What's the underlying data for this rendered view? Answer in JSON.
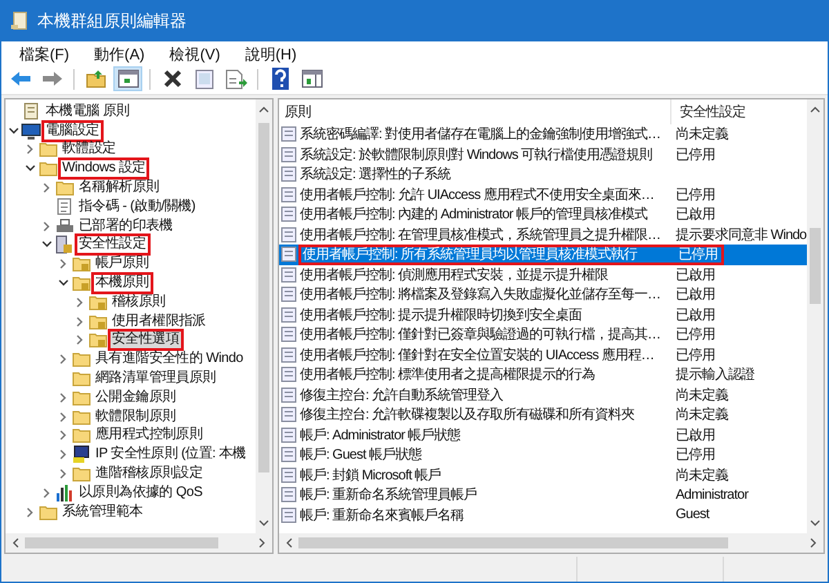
{
  "window": {
    "title": "本機群組原則編輯器"
  },
  "menu": [
    {
      "label": "檔案(F)"
    },
    {
      "label": "動作(A)"
    },
    {
      "label": "檢視(V)"
    },
    {
      "label": "說明(H)"
    }
  ],
  "toolbar": [
    {
      "kind": "back",
      "selected": false
    },
    {
      "kind": "forward",
      "selected": false
    },
    {
      "kind": "sep"
    },
    {
      "kind": "up",
      "selected": false
    },
    {
      "kind": "tree",
      "selected": true
    },
    {
      "kind": "sep"
    },
    {
      "kind": "delete",
      "selected": false
    },
    {
      "kind": "properties",
      "selected": false
    },
    {
      "kind": "export",
      "selected": false
    },
    {
      "kind": "sep"
    },
    {
      "kind": "help",
      "selected": false
    },
    {
      "kind": "pane",
      "selected": false
    }
  ],
  "tree": {
    "items": [
      {
        "label": "本機電腦 原則",
        "kind": "doc",
        "selected": false,
        "highlighted": false,
        "children": [
          {
            "label": "電腦設定",
            "kind": "computer",
            "expanded": true,
            "selected": false,
            "highlighted": true,
            "children": [
              {
                "label": "軟體設定",
                "kind": "folder",
                "expanded": false,
                "selected": false,
                "highlighted": false
              },
              {
                "label": "Windows 設定",
                "kind": "folder",
                "expanded": true,
                "selected": false,
                "highlighted": true,
                "children": [
                  {
                    "label": "名稱解析原則",
                    "kind": "folder",
                    "expanded": false,
                    "selected": false,
                    "highlighted": false
                  },
                  {
                    "label": "指令碼 - (啟動/關機)",
                    "kind": "script",
                    "selected": false,
                    "highlighted": false
                  },
                  {
                    "label": "已部署的印表機",
                    "kind": "printer",
                    "expanded": false,
                    "selected": false,
                    "highlighted": false
                  },
                  {
                    "label": "安全性設定",
                    "kind": "security",
                    "expanded": true,
                    "selected": false,
                    "highlighted": true,
                    "children": [
                      {
                        "label": "帳戶原則",
                        "kind": "lockfolder",
                        "expanded": false,
                        "selected": false,
                        "highlighted": false
                      },
                      {
                        "label": "本機原則",
                        "kind": "lockfolder",
                        "expanded": true,
                        "selected": false,
                        "highlighted": true,
                        "children": [
                          {
                            "label": "稽核原則",
                            "kind": "lockfolder",
                            "expanded": false,
                            "selected": false,
                            "highlighted": false
                          },
                          {
                            "label": "使用者權限指派",
                            "kind": "lockfolder",
                            "expanded": false,
                            "selected": false,
                            "highlighted": false
                          },
                          {
                            "label": "安全性選項",
                            "kind": "lockfolder",
                            "expanded": false,
                            "selected": true,
                            "highlighted": true
                          }
                        ]
                      },
                      {
                        "label": "具有進階安全性的 Windo",
                        "kind": "folder",
                        "expanded": false,
                        "selected": false,
                        "highlighted": false
                      },
                      {
                        "label": "網路清單管理員原則",
                        "kind": "folder",
                        "selected": false,
                        "highlighted": false
                      },
                      {
                        "label": "公開金鑰原則",
                        "kind": "folder",
                        "expanded": false,
                        "selected": false,
                        "highlighted": false
                      },
                      {
                        "label": "軟體限制原則",
                        "kind": "folder",
                        "expanded": false,
                        "selected": false,
                        "highlighted": false
                      },
                      {
                        "label": "應用程式控制原則",
                        "kind": "folder",
                        "expanded": false,
                        "selected": false,
                        "highlighted": false
                      },
                      {
                        "label": "IP 安全性原則 (位置: 本機",
                        "kind": "ipsec",
                        "expanded": false,
                        "selected": false,
                        "highlighted": false
                      },
                      {
                        "label": "進階稽核原則設定",
                        "kind": "folder",
                        "expanded": false,
                        "selected": false,
                        "highlighted": false
                      }
                    ]
                  },
                  {
                    "label": "以原則為依據的 QoS",
                    "kind": "chart",
                    "expanded": false,
                    "selected": false,
                    "highlighted": false
                  }
                ]
              },
              {
                "label": "系統管理範本",
                "kind": "folder",
                "expanded": false,
                "selected": false,
                "highlighted": false
              }
            ]
          }
        ]
      }
    ]
  },
  "table": {
    "columns": [
      {
        "label": "原則"
      },
      {
        "label": "安全性設定"
      }
    ],
    "rows": [
      {
        "policy": "系統密碼編譯: 對使用者儲存在電腦上的金鑰強制使用增強式…",
        "setting": "尚未定義",
        "selected": false,
        "highlighted": false
      },
      {
        "policy": "系統設定: 於軟體限制原則對 Windows 可執行檔使用憑證規則",
        "setting": "已停用",
        "selected": false,
        "highlighted": false
      },
      {
        "policy": "系統設定: 選擇性的子系統",
        "selected": false,
        "highlighted": false
      },
      {
        "policy": "使用者帳戶控制: 允許 UIAccess 應用程式不使用安全桌面來…",
        "setting": "已停用",
        "selected": false,
        "highlighted": false
      },
      {
        "policy": "使用者帳戶控制: 內建的 Administrator 帳戶的管理員核准模式",
        "setting": "已啟用",
        "selected": false,
        "highlighted": false
      },
      {
        "policy": "使用者帳戶控制: 在管理員核准模式，系統管理員之提升權限…",
        "setting": "提示要求同意非 Windo",
        "selected": false,
        "highlighted": false
      },
      {
        "policy": "使用者帳戶控制: 所有系統管理員均以管理員核准模式執行",
        "setting": "已停用",
        "selected": true,
        "highlighted": true
      },
      {
        "policy": "使用者帳戶控制: 偵測應用程式安裝，並提示提升權限",
        "setting": "已啟用",
        "selected": false,
        "highlighted": false
      },
      {
        "policy": "使用者帳戶控制: 將檔案及登錄寫入失敗虛擬化並儲存至每一…",
        "setting": "已啟用",
        "selected": false,
        "highlighted": false
      },
      {
        "policy": "使用者帳戶控制: 提示提升權限時切換到安全桌面",
        "setting": "已啟用",
        "selected": false,
        "highlighted": false
      },
      {
        "policy": "使用者帳戶控制: 僅針對已簽章與驗證過的可執行檔，提高其…",
        "setting": "已停用",
        "selected": false,
        "highlighted": false
      },
      {
        "policy": "使用者帳戶控制: 僅針對在安全位置安裝的 UIAccess 應用程…",
        "setting": "已停用",
        "selected": false,
        "highlighted": false
      },
      {
        "policy": "使用者帳戶控制: 標準使用者之提高權限提示的行為",
        "setting": "提示輸入認證",
        "selected": false,
        "highlighted": false
      },
      {
        "policy": "修復主控台: 允許自動系統管理登入",
        "setting": "尚未定義",
        "selected": false,
        "highlighted": false
      },
      {
        "policy": "修復主控台: 允許軟碟複製以及存取所有磁碟和所有資料夾",
        "setting": "尚未定義",
        "selected": false,
        "highlighted": false
      },
      {
        "policy": "帳戶: Administrator 帳戶狀態",
        "setting": "已啟用",
        "selected": false,
        "highlighted": false
      },
      {
        "policy": "帳戶: Guest 帳戶狀態",
        "setting": "已停用",
        "selected": false,
        "highlighted": false
      },
      {
        "policy": "帳戶: 封鎖 Microsoft 帳戶",
        "setting": "尚未定義",
        "selected": false,
        "highlighted": false
      },
      {
        "policy": "帳戶: 重新命名系統管理員帳戶",
        "setting": "Administrator",
        "selected": false,
        "highlighted": false
      },
      {
        "policy": "帳戶: 重新命名來賓帳戶名稱",
        "setting": "Guest",
        "selected": false,
        "highlighted": false
      }
    ]
  }
}
